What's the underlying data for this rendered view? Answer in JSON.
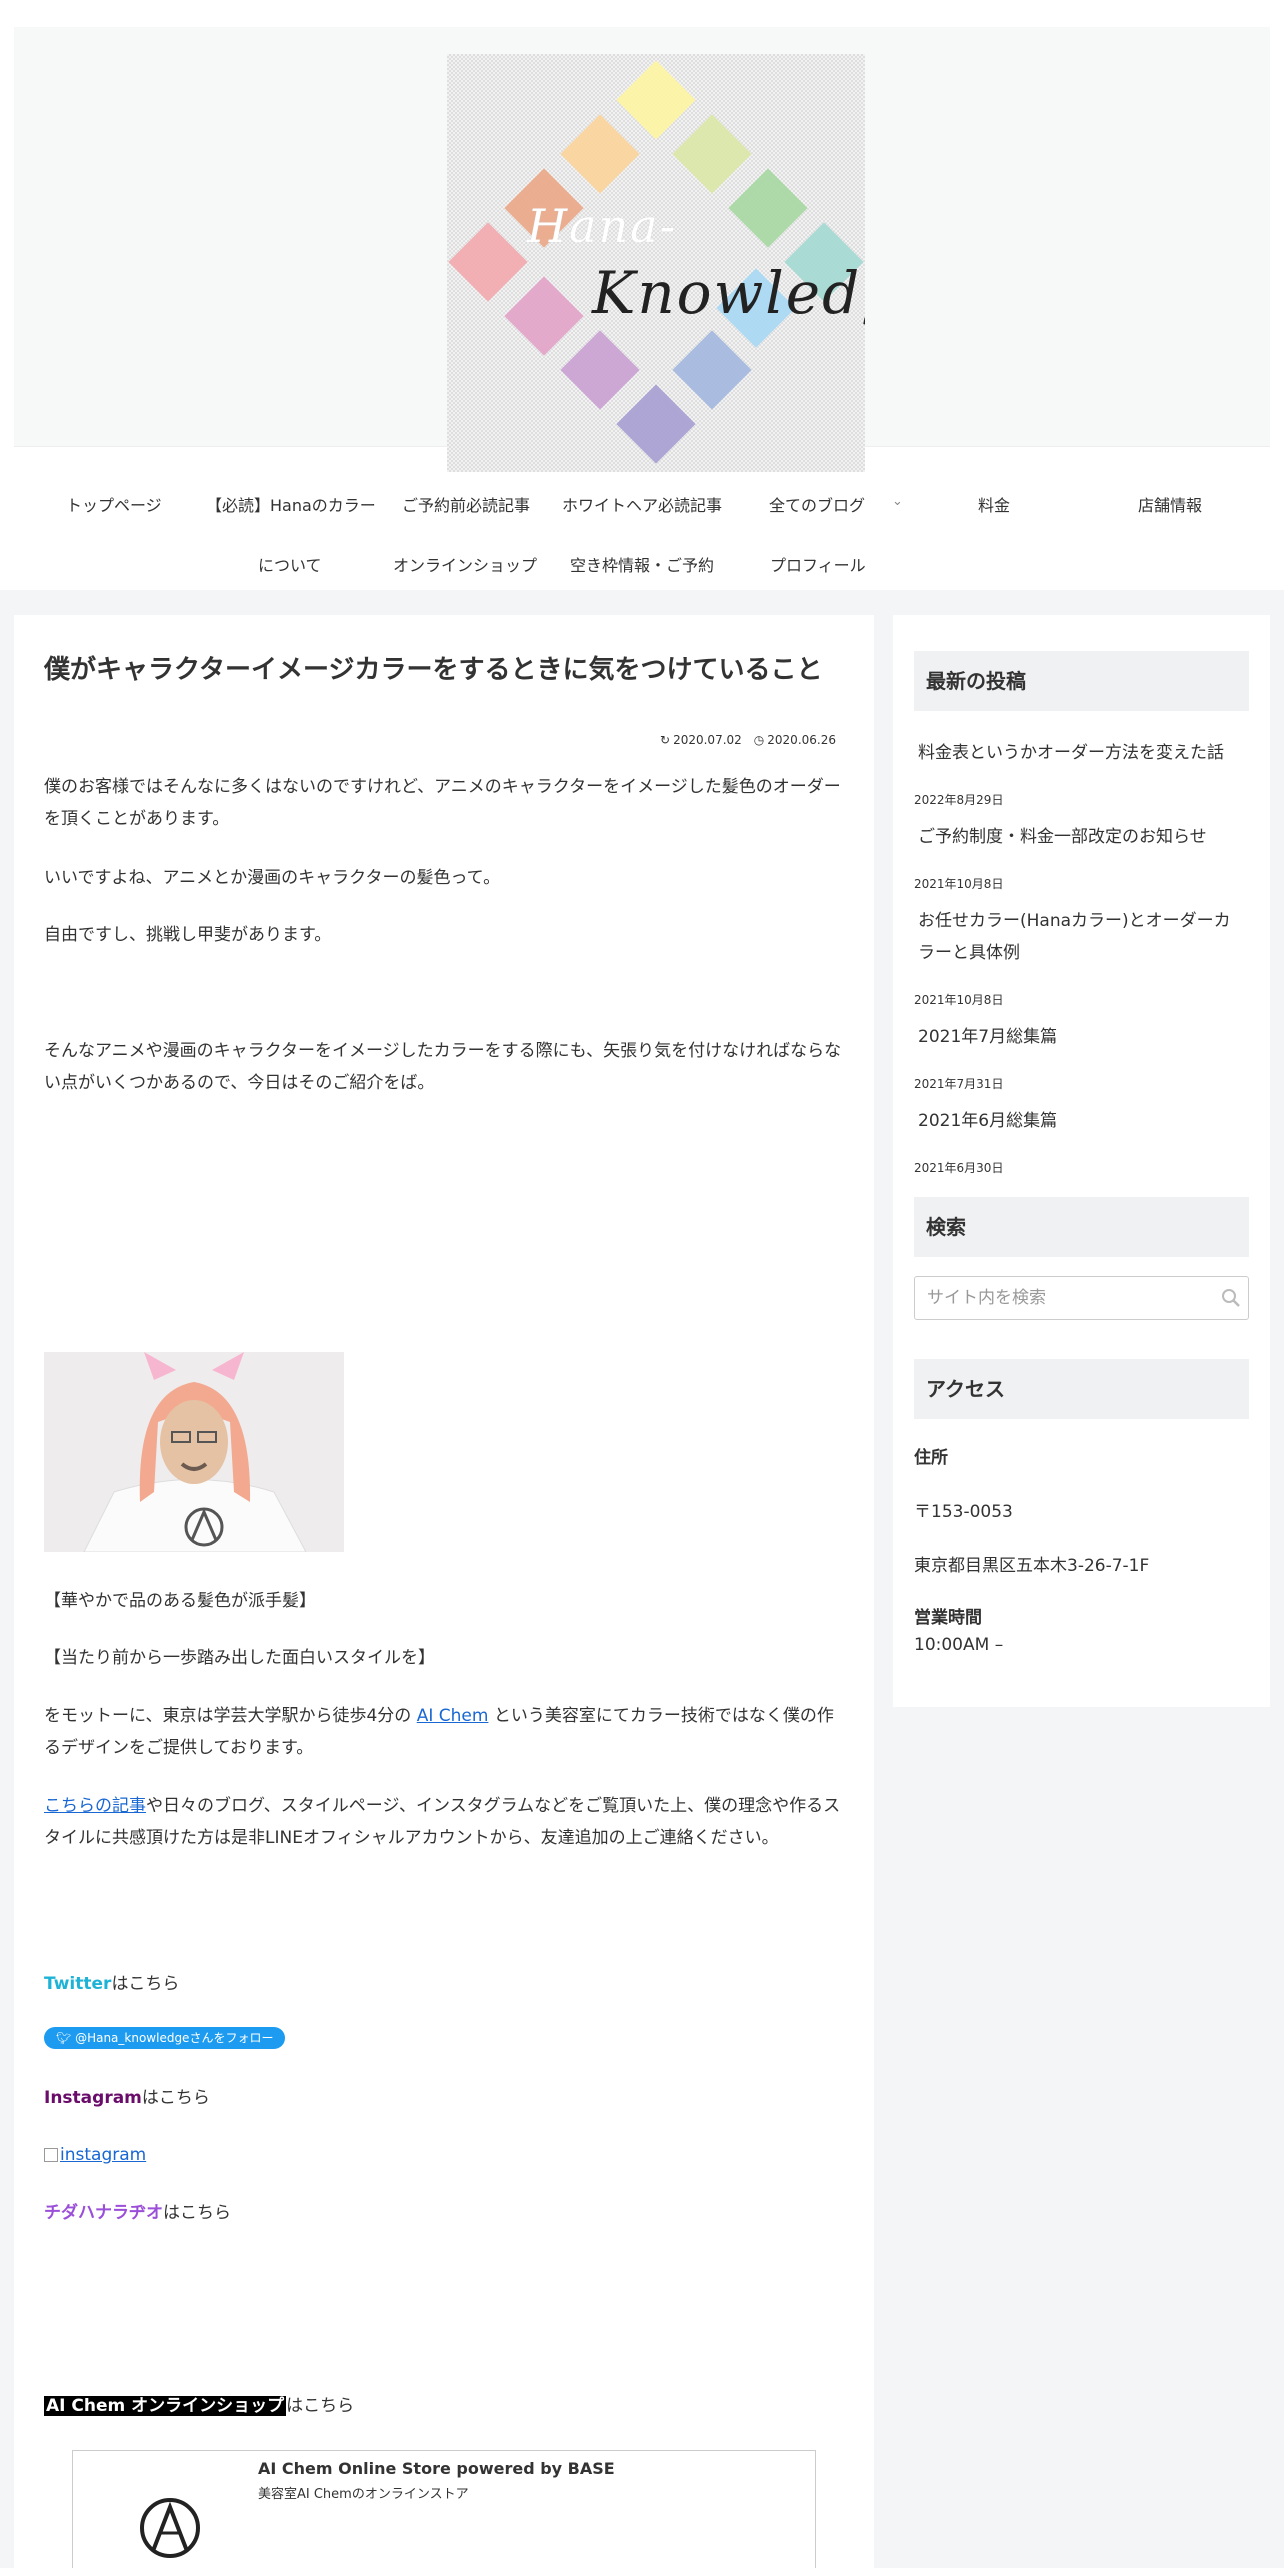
{
  "header": {
    "logo_line1": "Hana-",
    "logo_line2": "Knowledge"
  },
  "nav": {
    "items": [
      "トップページ",
      "【必読】Hanaのカラー",
      "について",
      "ご予約前必読記事",
      "ホワイトヘア必読記事",
      "全てのブログ",
      "料金",
      "店舗情報",
      "オンラインショップ",
      "空き枠情報・ご予約",
      "プロフィール"
    ]
  },
  "article": {
    "title": "僕がキャラクターイメージカラーをするときに気をつけていること",
    "updated": "2020.07.02",
    "published": "2020.06.26",
    "p1": "僕のお客様ではそんなに多くはないのですけれど、アニメのキャラクターをイメージした髪色のオーダーを頂くことがあります。",
    "p2": "いいですよね、アニメとか漫画のキャラクターの髪色って。",
    "p3": "自由ですし、挑戦し甲斐があります。",
    "p4": "そんなアニメや漫画のキャラクターをイメージしたカラーをする際にも、矢張り気を付けなければならない点がいくつかあるので、今日はそのご紹介をば。",
    "p5": "【華やかで品のある髪色が派手髪】",
    "p6": "【当たり前から一歩踏み出した面白いスタイルを】",
    "p7_pre": "をモットーに、東京は学芸大学駅から徒歩4分の ",
    "p7_link": "AI Chem",
    "p7_post": " という美容室にてカラー技術ではなく僕の作るデザインをご提供しております。",
    "p8_link": "こちらの記事",
    "p8_post": "や日々のブログ、スタイルページ、インスタグラムなどをご覧頂いた上、僕の理念や作るスタイルに共感頂けた方は是非LINEオフィシャルアカウントから、友達追加の上ご連絡ください。",
    "twitter_label": "Twitter",
    "twitter_suffix": "はこちら",
    "twitter_button": "@Hana_knowledgeさんをフォロー",
    "instagram_label": "Instagram",
    "instagram_suffix": "はこちら",
    "instagram_img_alt": "instagram",
    "radio_label": "チダハナラヂオ",
    "radio_suffix": "はこちら",
    "shop_label": "AI Chem オンラインショップ",
    "shop_suffix": "はこちら",
    "shop_card_title": "AI Chem Online Store powered by BASE",
    "shop_card_desc": "美容室AI Chemのオンラインストア"
  },
  "sidebar": {
    "recent_heading": "最新の投稿",
    "posts": [
      {
        "title": "料金表というかオーダー方法を変えた話",
        "date": "2022年8月29日"
      },
      {
        "title": "ご予約制度・料金一部改定のお知らせ",
        "date": "2021年10月8日"
      },
      {
        "title": "お任せカラー(Hanaカラー)とオーダーカラーと具体例",
        "date": "2021年10月8日"
      },
      {
        "title": "2021年7月総集篇",
        "date": "2021年7月31日"
      },
      {
        "title": "2021年6月総集篇",
        "date": "2021年6月30日"
      }
    ],
    "search_heading": "検索",
    "search_placeholder": "サイト内を検索",
    "access_heading": "アクセス",
    "address_label": "住所",
    "postal": "〒153-0053",
    "address": "東京都目黒区五本木3-26-7-1F",
    "hours_label": "営業時間",
    "hours": "10:00AM –"
  },
  "colors": {
    "twitter": "#1eb3d6",
    "instagram": "#6a0d6a",
    "radio": "#9b4fd9",
    "link": "#1967d2",
    "sidebar_head_bg": "#f0f1f2"
  }
}
